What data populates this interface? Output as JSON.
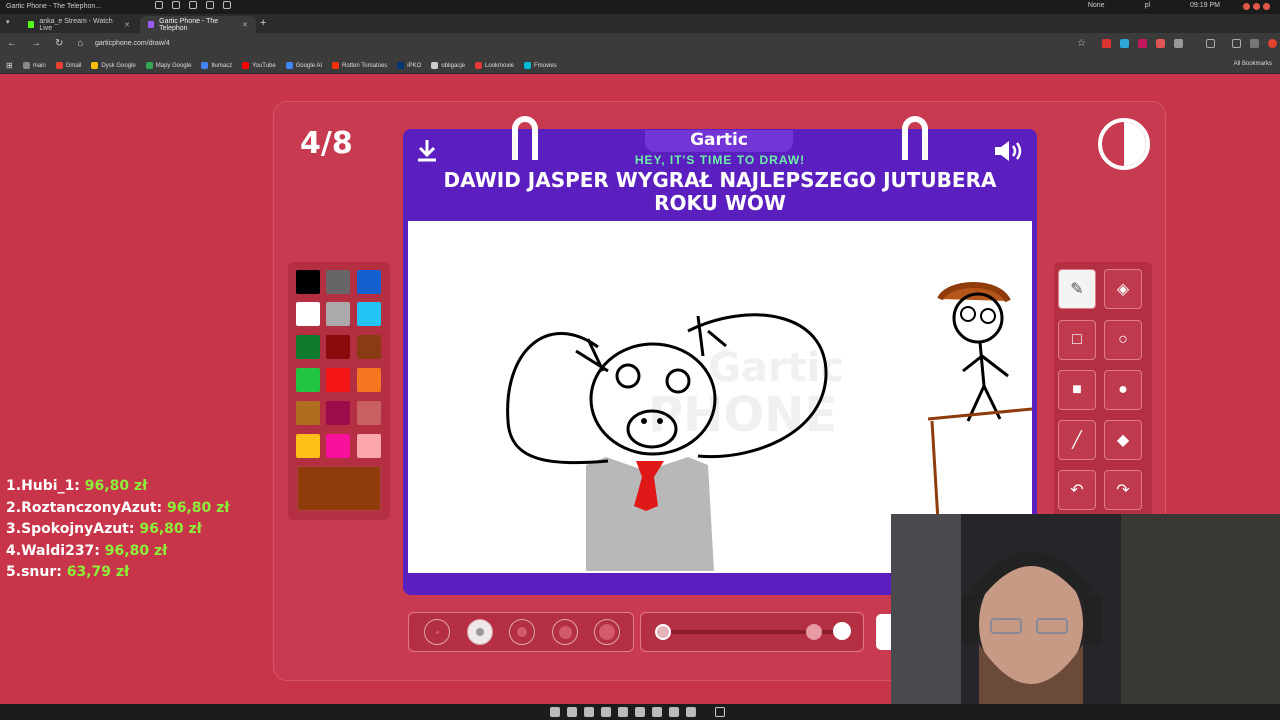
{
  "os": {
    "window_title": "Gartic Phone - The Telephon...",
    "indicator": "None",
    "keyboard_layout": "pl",
    "clock": "09:19 PM"
  },
  "browser": {
    "tabs": [
      {
        "label": "anka_e Stream - Watch Live",
        "active": false,
        "favicon_color": "#53fc18"
      },
      {
        "label": "Gartic Phone - The Telephon",
        "active": true,
        "favicon_color": "#9b5cff"
      }
    ],
    "url": "garticphone.com/draw/4",
    "bookmarks": [
      {
        "label": "main",
        "color": "#888888"
      },
      {
        "label": "Gmail",
        "color": "#ea4335"
      },
      {
        "label": "Dysk Google",
        "color": "#fbbc04"
      },
      {
        "label": "Mapy Google",
        "color": "#34a853"
      },
      {
        "label": "tłumacz",
        "color": "#4285f4"
      },
      {
        "label": "YouTube",
        "color": "#ff0000"
      },
      {
        "label": "Google AI",
        "color": "#4285f4"
      },
      {
        "label": "Rotten Tomatoes",
        "color": "#fa320a"
      },
      {
        "label": "iPKO",
        "color": "#003574"
      },
      {
        "label": "obligacje",
        "color": "#cccccc"
      },
      {
        "label": "Lookmovie",
        "color": "#e53935"
      },
      {
        "label": "Fmovies",
        "color": "#00bcd4"
      }
    ],
    "all_bookmarks": "All Bookmarks"
  },
  "game": {
    "round": "4/8",
    "logo": "Gartic",
    "subtitle": "HEY, IT'S TIME TO DRAW!",
    "prompt": "DAWID JASPER WYGRAŁ NAJLEPSZEGO JUTUBERA ROKU WOW",
    "palette": [
      "#000000",
      "#666666",
      "#1560d0",
      "#ffffff",
      "#aaaaaa",
      "#21c4f6",
      "#0e7a2c",
      "#8a0b0b",
      "#8a3b12",
      "#23c441",
      "#f41414",
      "#f67722",
      "#b06d21",
      "#9c0b4a",
      "#c85f61",
      "#fbbf15",
      "#f6109b",
      "#fba7aa"
    ],
    "current_color": "#8f3b0c",
    "tools": [
      "pen-icon",
      "eraser-icon",
      "rect-outline-icon",
      "ellipse-outline-icon",
      "rect-fill-icon",
      "ellipse-fill-icon",
      "line-icon",
      "bucket-icon",
      "undo-icon",
      "redo-icon"
    ],
    "selected_tool": "pen-icon",
    "brush_sizes": 5,
    "selected_brush_size": 2,
    "opacity": 1.0
  },
  "leaderboard": [
    {
      "rank": "1.",
      "name": "Hubi_1:",
      "amount": "96,80 zł"
    },
    {
      "rank": "2.",
      "name": "RoztanczonyAzut:",
      "amount": "96,80 zł"
    },
    {
      "rank": "3.",
      "name": "SpokojnyAzut:",
      "amount": "96,80 zł"
    },
    {
      "rank": "4.",
      "name": "Waldi237:",
      "amount": "96,80 zł"
    },
    {
      "rank": "5.",
      "name": "snur:",
      "amount": "63,79 zł"
    }
  ]
}
